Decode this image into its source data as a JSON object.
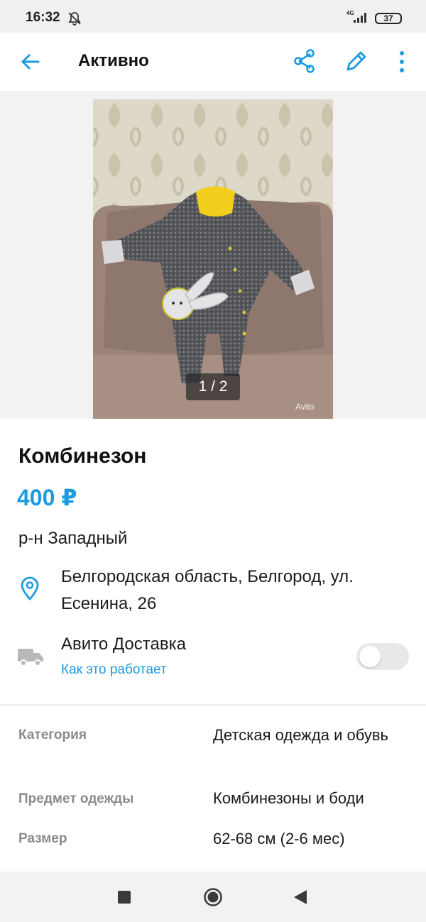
{
  "status_bar": {
    "time": "16:32",
    "network": "4G",
    "battery": "37",
    "icons": [
      "bell-muted-icon",
      "signal-icon",
      "battery-icon"
    ]
  },
  "app_bar": {
    "title": "Активно",
    "icons": [
      "back-arrow-icon",
      "share-icon",
      "edit-pencil-icon",
      "more-vertical-icon"
    ],
    "accent_color": "#1d9be0"
  },
  "gallery": {
    "counter": "1 / 2",
    "watermark": "Avito"
  },
  "listing": {
    "title": "Комбинезон",
    "price": "400 ₽",
    "district": "р-н Западный",
    "address": "Белгородская область, Белгород, ул. Есенина, 26"
  },
  "delivery": {
    "title": "Авито Доставка",
    "link": "Как это работает",
    "enabled": false
  },
  "params": [
    {
      "label": "Категория",
      "value": "Детская одежда и обувь"
    },
    {
      "label": "Предмет одежды",
      "value": "Комбинезоны и боди"
    },
    {
      "label": "Размер",
      "value": "62-68 см (2-6 мес)"
    }
  ],
  "nav_bar": {
    "icons": [
      "recents-square-icon",
      "home-circle-icon",
      "back-triangle-icon"
    ]
  }
}
